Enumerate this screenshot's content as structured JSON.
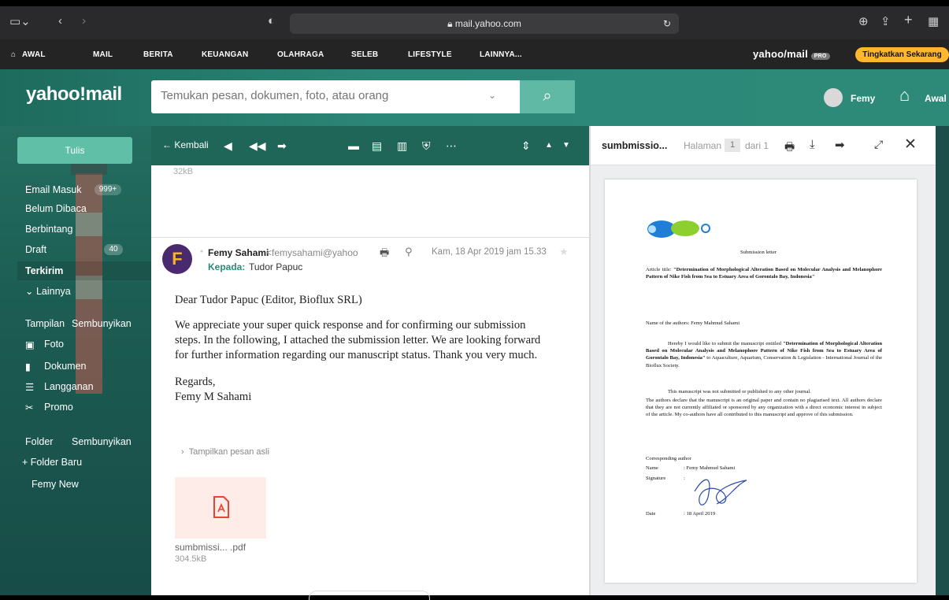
{
  "browser": {
    "url": "mail.yahoo.com"
  },
  "topnav": {
    "items": [
      "AWAL",
      "MAIL",
      "BERITA",
      "KEUANGAN",
      "OLAHRAGA",
      "SELEB",
      "LIFESTYLE",
      "LAINNYA..."
    ],
    "logo": "yahoo/mail",
    "logo_badge": "PRO",
    "upgrade": "Tingkatkan Sekarang"
  },
  "header": {
    "logo": "yahoo!mail",
    "search_placeholder": "Temukan pesan, dokumen, foto, atau orang",
    "user": "Femy",
    "home": "Awal"
  },
  "sidebar": {
    "compose": "Tulis",
    "folders": [
      {
        "label": "Email Masuk",
        "badge": "999+"
      },
      {
        "label": "Belum Dibaca"
      },
      {
        "label": "Berbintang"
      },
      {
        "label": "Draft",
        "badge": "40"
      },
      {
        "label": "Terkirim"
      },
      {
        "label": "Lainnya"
      }
    ],
    "views_label": "Tampilan",
    "views_hide": "Sembunyikan",
    "views": [
      "Foto",
      "Dokumen",
      "Langganan",
      "Promo"
    ],
    "folder_label": "Folder",
    "folder_hide": "Sembunyikan",
    "new_folder": "+ Folder Baru",
    "custom_folders": [
      "Femy New"
    ]
  },
  "toolbar": {
    "back": "Kembali"
  },
  "message": {
    "prev_size": "32kB",
    "sender_name": "Femy Sahami",
    "sender_email": "<femysahami@yahoo",
    "date": "Kam, 18 Apr 2019 jam 15.33",
    "to_label": "Kepada:",
    "to": "Tudor Papuc",
    "greeting": "Dear Tudor Papuc (Editor, Bioflux SRL)",
    "body_lines": [
      "We appreciate your super quick response and for confirming our submission",
      "steps. In the following, I attached the submission letter. We are looking forward",
      "for further information regarding our manuscript status. Thank you very much."
    ],
    "signoff": "Regards,",
    "signature": "Femy M Sahami",
    "show_original": "Tampilkan pesan asli",
    "attachment_name": "sumbmissi... .pdf",
    "attachment_size": "304.5kB"
  },
  "pdf_viewer": {
    "title": "sumbmissio...",
    "page_label": "Halaman",
    "page_num": "1",
    "page_of": "dari 1",
    "doc": {
      "heading": "Submission letter",
      "title_prefix": "Article title: ",
      "title_bold": "\"Determination of Morphological Alteration Based on Molecular Analysis and Melanophore Pattern of Nike Fish from Sea to Estuary Area of Gorontalo Bay, Indonesia\"",
      "authors": "Name of the authors: Femy Mahmud Sahami",
      "para1_start": "Hereby I would like to submit the manuscript entitled ",
      "para1_bold": "\"Determination of Morphological Alteration Based on Molecular Analysis and Melanophore Pattern of Nike Fish from Sea to Estuary Area of Gorontalo Bay, Indonesia\"",
      "para1_end": " to Aquaculture, Aquarium, Conservation & Legislation - International Journal of the Bioflux Society.",
      "para2": "This manuscript was not submitted or published to any other journal.",
      "para3": "The authors declare that the manuscript is an original paper and contain no plagiarised text. All authors declare that they are not currently affiliated or sponsored by any organization with a direct economic interest in subject of the article. My co-authors have all contributed to this manuscript and approve of this submission.",
      "corr": "Corresponding author",
      "name_label": "Name",
      "name_value": ": Femy Mahmud Sahami",
      "sig_label": "Signature",
      "sig_value": ":",
      "date_label": "Date",
      "date_value": ": 18 April 2019"
    }
  }
}
